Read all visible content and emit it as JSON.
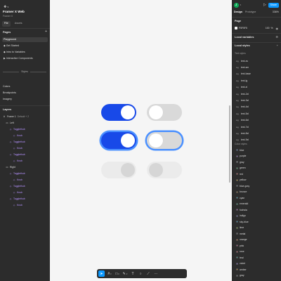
{
  "file": {
    "title": "Framer X Web",
    "subtitle": "Framer X"
  },
  "left_tabs": [
    "File",
    "Assets"
  ],
  "pages": {
    "header": "Pages",
    "items": [
      "Playground",
      "Get Started",
      "Intro to Variables",
      "Interactive Components"
    ]
  },
  "styles_label": "Styles",
  "side_items": [
    "Colors",
    "Breakpoints",
    "Imagery"
  ],
  "layers": {
    "header": "Layers",
    "frame": "Frame 1",
    "frame_meta": "Default + 2",
    "items": [
      {
        "label": "Left",
        "indent": 1,
        "purple": false
      },
      {
        "label": "Togglethub",
        "indent": 2,
        "purple": true
      },
      {
        "label": "Knob",
        "indent": 3,
        "purple": true
      },
      {
        "label": "Togglethub",
        "indent": 2,
        "purple": true
      },
      {
        "label": "Knob",
        "indent": 3,
        "purple": true
      },
      {
        "label": "Togglethub",
        "indent": 2,
        "purple": true
      },
      {
        "label": "Knob",
        "indent": 3,
        "purple": true
      },
      {
        "label": "Right",
        "indent": 1,
        "purple": false
      },
      {
        "label": "Togglethub",
        "indent": 2,
        "purple": true
      },
      {
        "label": "Knob",
        "indent": 3,
        "purple": true
      },
      {
        "label": "Togglethub",
        "indent": 2,
        "purple": true
      },
      {
        "label": "Knob",
        "indent": 3,
        "purple": true
      },
      {
        "label": "Togglethub",
        "indent": 2,
        "purple": true
      },
      {
        "label": "Knob",
        "indent": 3,
        "purple": true
      }
    ]
  },
  "toggles": [
    {
      "state": "on",
      "variant": "default"
    },
    {
      "state": "off",
      "variant": "default"
    },
    {
      "state": "on",
      "variant": "focus"
    },
    {
      "state": "off",
      "variant": "focus"
    },
    {
      "state": "on",
      "variant": "disabled"
    },
    {
      "state": "off",
      "variant": "disabled"
    }
  ],
  "toolbar": {
    "tools": [
      "move-icon",
      "frame-icon",
      "shape-icon",
      "pen-icon",
      "text-icon",
      "comment-icon",
      "present-icon",
      "more-icon"
    ]
  },
  "right": {
    "avatar": "J",
    "share_label": "Share",
    "tabs": [
      "Design",
      "Prototype"
    ],
    "zoom": "336%",
    "page_header": "Page",
    "fill_hex": "F5F5F5",
    "fill_opacity": "100",
    "fill_unit": "%",
    "local_variables": "Local variables",
    "local_styles": "Local styles",
    "text_styles_label": "Text styles",
    "text_styles": [
      "text-xs",
      "text-sm",
      "text-base",
      "text-lg",
      "text-xl",
      "text-2xl",
      "text-3xl",
      "text-4xl",
      "text-5xl",
      "text-6xl",
      "text-7xl",
      "text-8xl",
      "text-9xl"
    ],
    "color_styles_label": "Color styles",
    "color_styles": [
      {
        "name": "blue",
        "color": "#3b82f6"
      },
      {
        "name": "purple",
        "color": "#a855f7"
      },
      {
        "name": "gray",
        "color": "#9ca3af"
      },
      {
        "name": "green",
        "color": "#22c55e"
      },
      {
        "name": "red",
        "color": "#ef4444"
      },
      {
        "name": "yellow",
        "color": "#eab308"
      },
      {
        "name": "blue-gray",
        "color": "#64748b"
      },
      {
        "name": "bronze",
        "color": "#a16207"
      },
      {
        "name": "cyan",
        "color": "#06b6d4"
      },
      {
        "name": "emerald",
        "color": "#10b981"
      },
      {
        "name": "fuchsia",
        "color": "#d946ef"
      },
      {
        "name": "indigo",
        "color": "#6366f1"
      },
      {
        "name": "sky-blue",
        "color": "#0ea5e9"
      },
      {
        "name": "lime",
        "color": "#84cc16"
      },
      {
        "name": "metal",
        "color": "#71717a"
      },
      {
        "name": "orange",
        "color": "#f97316"
      },
      {
        "name": "pink",
        "color": "#ec4899"
      },
      {
        "name": "rose",
        "color": "#f43f5e"
      },
      {
        "name": "teal",
        "color": "#14b8a6"
      },
      {
        "name": "violet",
        "color": "#8b5cf6"
      },
      {
        "name": "amber",
        "color": "#f59e0b"
      },
      {
        "name": "gray",
        "color": "#6b7280"
      }
    ]
  },
  "colors": {
    "toggle_on": "#1849e8",
    "toggle_off": "#d9d9d9",
    "focus_ring": "#4a90ff",
    "disabled_track": "#ebebeb",
    "disabled_knob": "#d6d6d6"
  }
}
